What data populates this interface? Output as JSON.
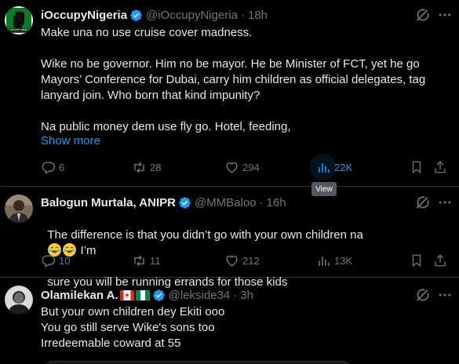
{
  "tweets": [
    {
      "name": "iOccupyNigeria",
      "handle": "@iOccupyNigeria",
      "time": "18h",
      "text": "Make una no use cruise cover madness.\n\nWike no be governor. Him no be mayor. He be Minister of FCT, yet he go Mayors’ Conference for Dubai, carry him children as official delegates, tag lanyard join. Who born that kind impunity?\n\nNa public money dem use fly go. Hotel, feeding,",
      "show_more": "Show more",
      "replies": "6",
      "reposts": "28",
      "likes": "294",
      "views": "22K",
      "tooltip": "View",
      "avatar_label": "OCCUPY NIGERIA"
    },
    {
      "name": "Balogun Murtala, ANIPR",
      "handle": "@MMBaloo",
      "time": "16h",
      "text_before": "The difference is that you didn’t go with your own children na",
      "text_after": " I’m",
      "text_line2": "sure you will be running errands for those kids",
      "emojis": [
        "face-with-tears-of-joy",
        "face-with-tears-of-joy"
      ],
      "replies": "10",
      "reposts": "11",
      "likes": "212",
      "views": "13K"
    },
    {
      "name": "Olamilekan A.",
      "handle": "@lekside34",
      "time": "3h",
      "flags": [
        "canada-flag",
        "nigeria-flag"
      ],
      "text": "But your own children dey Ekiti ooo\nYou go still serve Wike's sons too\nIrredeemable coward at 55"
    }
  ],
  "dot": "·",
  "colors": {
    "accent": "#1d9bf0",
    "muted": "#71767b",
    "text": "#e7e9ea",
    "background": "#000000"
  }
}
